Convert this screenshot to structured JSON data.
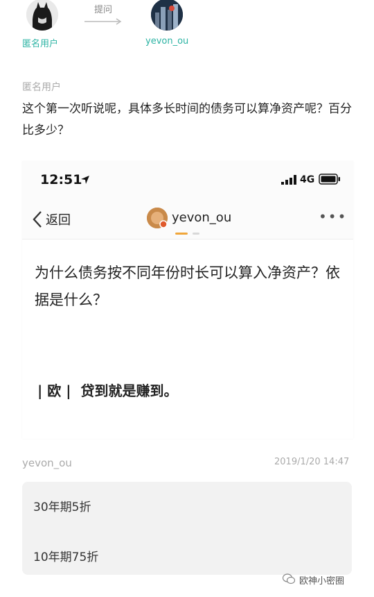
{
  "flow": {
    "asker": "匿名用户",
    "action": "提问",
    "answerer": "yevon_ou"
  },
  "question": {
    "user": "匿名用户",
    "text": "这个第一次听说呢，具体多长时间的债务可以算净资产呢？百分比多少？"
  },
  "phone": {
    "status_time": "12:51",
    "network": "4G",
    "back_label": "返回",
    "nav_title": "yevon_ou",
    "more": "•••",
    "question_text": "为什么债务按不同年份时长可以算入净资产？依据是什么？",
    "answer_text": "| 欧 |  贷到就是赚到。"
  },
  "answer": {
    "user": "yevon_ou",
    "date": "2019/1/20 14:47",
    "lines": [
      "30年期5折",
      "10年期75折"
    ]
  },
  "watermark": "欧神小密圈",
  "colors": {
    "accent_teal": "#2bb3a3",
    "nav_orange": "#f0a63a"
  }
}
